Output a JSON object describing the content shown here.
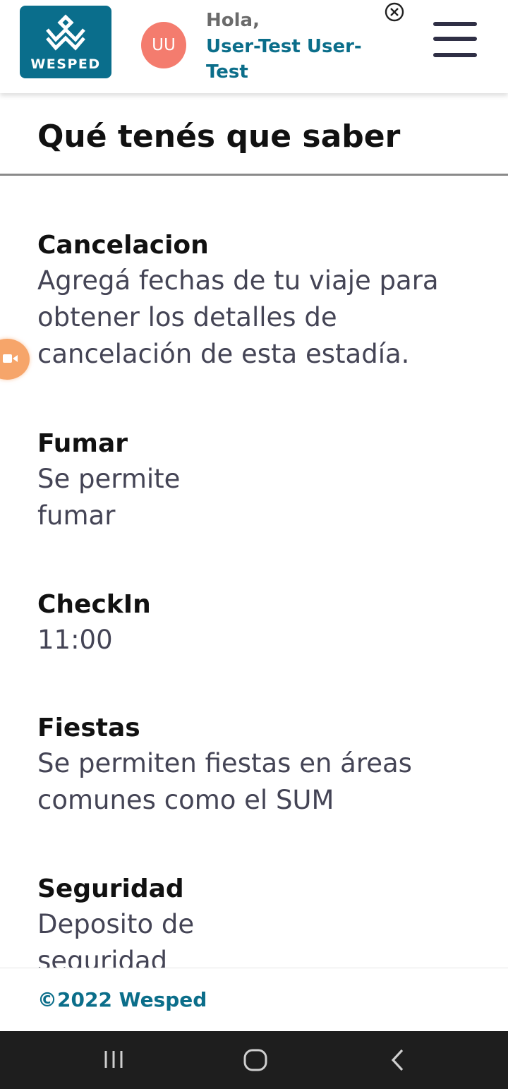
{
  "header": {
    "logo_text": "WESPED",
    "avatar_initials": "UU",
    "greeting": "Hola,",
    "username": "User-Test User-Test",
    "icons": {
      "close": "close-icon",
      "menu": "hamburger-menu-icon"
    }
  },
  "main": {
    "title": "Qué tenés que saber",
    "items": [
      {
        "title": "Cancelacion",
        "text": "Agregá fechas de tu viaje para obtener los detalles de cancelación de esta estadía."
      },
      {
        "title": "Fumar",
        "text": "Se permite fumar"
      },
      {
        "title": "CheckIn",
        "text": "11:00"
      },
      {
        "title": "Fiestas",
        "text": "Se permiten fiestas en áreas comunes como el SUM"
      },
      {
        "title": "Seguridad",
        "text": "Deposito de seguridad"
      }
    ]
  },
  "footer": {
    "copyright": "©2022 Wesped"
  },
  "colors": {
    "brand": "#0a6e8c",
    "avatar": "#f47c6e",
    "accent_bubble": "#f6a56a"
  }
}
